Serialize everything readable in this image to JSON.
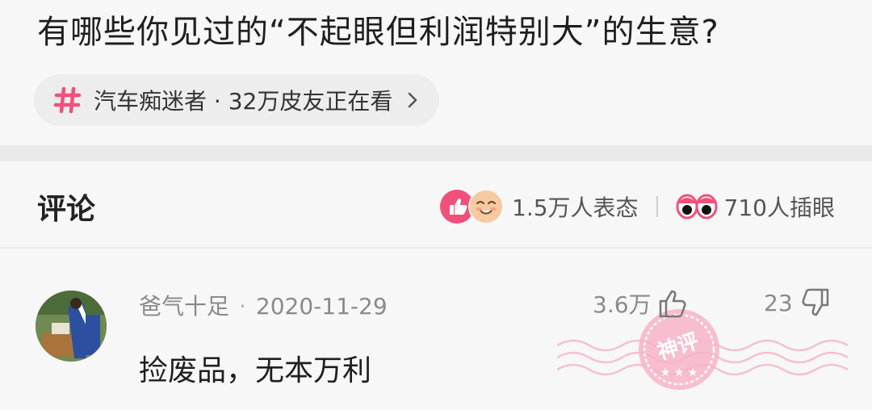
{
  "post": {
    "title": "有哪些你见过的“不起眼但利润特别大”的生意?"
  },
  "topic": {
    "text": "汽车痴迷者 · 32万皮友正在看",
    "icon": "hash-icon",
    "accent": "#f0507a"
  },
  "comments_section": {
    "title": "评论",
    "reactions_text": "1.5万人表态",
    "eyes_text": "710人插眼"
  },
  "comment": {
    "author": "爸气十足",
    "date": "2020-11-29",
    "likes": "3.6万",
    "dislikes": "23",
    "text": "捡废品，无本万利",
    "badge": "神评"
  }
}
